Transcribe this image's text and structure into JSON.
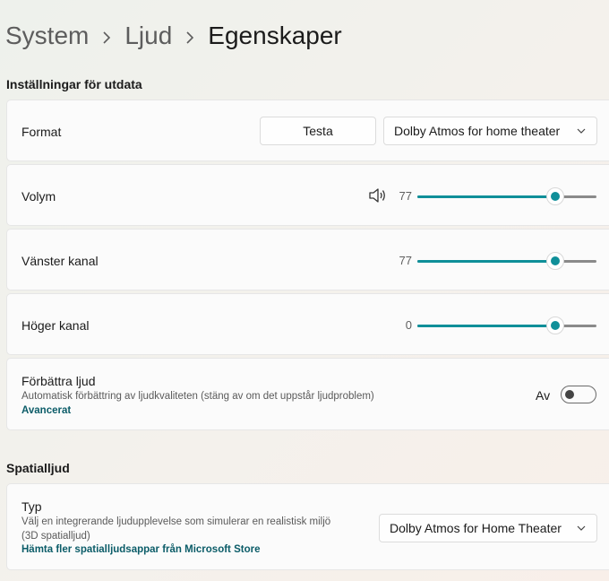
{
  "breadcrumb": {
    "items": [
      "System",
      "Ljud",
      "Egenskaper"
    ]
  },
  "output_section": {
    "title": "Inställningar för utdata",
    "format": {
      "label": "Format",
      "test_button": "Testa",
      "selected": "Dolby Atmos for home theater"
    },
    "volume": {
      "label": "Volym",
      "value": "77",
      "level": 0.77,
      "icon": "speaker-icon"
    },
    "left_channel": {
      "label": "Vänster kanal",
      "value": "77",
      "level": 0.77
    },
    "right_channel": {
      "label": "Höger kanal",
      "value": "0",
      "level": 0.77
    },
    "enhance": {
      "title": "Förbättra ljud",
      "description": "Automatisk förbättring av ljudkvaliteten (stäng av om det uppstår ljudproblem)",
      "link": "Avancerat",
      "state_label": "Av",
      "enabled": false
    }
  },
  "spatial_section": {
    "title": "Spatialljud",
    "type": {
      "title": "Typ",
      "description_line1": "Välj en integrerande ljudupplevelse som simulerar en realistisk miljö",
      "description_line2": "(3D spatialljud)",
      "link": "Hämta fler spatialljudsappar från Microsoft Store",
      "selected": "Dolby Atmos for Home Theater"
    }
  },
  "colors": {
    "accent": "#0f8f99",
    "link": "#0b5c68"
  }
}
